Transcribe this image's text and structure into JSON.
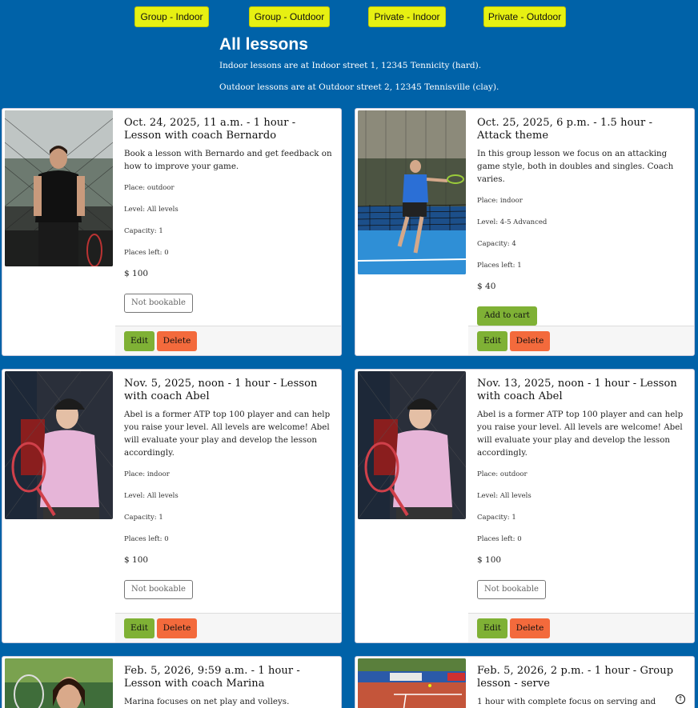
{
  "filters": [
    "Group - Indoor",
    "Group - Outdoor",
    "Private - Indoor",
    "Private - Outdoor"
  ],
  "header": {
    "title": "All lessons",
    "indoor_note": "Indoor lessons are at Indoor street 1, 12345 Tennicity (hard).",
    "outdoor_note": "Outdoor lessons are at Outdoor street 2, 12345 Tennisville (clay)."
  },
  "labels": {
    "not_bookable": "Not bookable",
    "add_to_cart": "Add to cart",
    "edit": "Edit",
    "delete": "Delete"
  },
  "lessons": [
    {
      "title": "Oct. 24, 2025, 11 a.m. - 1 hour - Lesson with coach Bernardo",
      "description": "Book a lesson with Bernardo and get feedback on how to improve your game.",
      "place": "Place: outdoor",
      "level": "Level: All levels",
      "capacity": "Capacity: 1",
      "places_left": "Places left: 0",
      "price": "$ 100"
    },
    {
      "title": "Oct. 25, 2025, 6 p.m. - 1.5 hour - Attack theme",
      "description": "In this group lesson we focus on an attacking game style, both in doubles and singles. Coach varies.",
      "place": "Place: indoor",
      "level": "Level: 4-5 Advanced",
      "capacity": "Capacity: 4",
      "places_left": "Places left: 1",
      "price": "$ 40"
    },
    {
      "title": "Nov. 5, 2025, noon - 1 hour - Lesson with coach Abel",
      "description": "Abel is a former ATP top 100 player and can help you raise your level. All levels are welcome! Abel will evaluate your play and develop the lesson accordingly.",
      "place": "Place: indoor",
      "level": "Level: All levels",
      "capacity": "Capacity: 1",
      "places_left": "Places left: 0",
      "price": "$ 100"
    },
    {
      "title": "Nov. 13, 2025, noon - 1 hour - Lesson with coach Abel",
      "description": "Abel is a former ATP top 100 player and can help you raise your level. All levels are welcome! Abel will evaluate your play and develop the lesson accordingly.",
      "place": "Place: outdoor",
      "level": "Level: All levels",
      "capacity": "Capacity: 1",
      "places_left": "Places left: 0",
      "price": "$ 100"
    },
    {
      "title": "Feb. 5, 2026, 9:59 a.m. - 1 hour - Lesson with coach Marina",
      "description": "Marina focuses on net play and volleys."
    },
    {
      "title": "Feb. 5, 2026, 2 p.m. - 1 hour - Group lesson - serve",
      "description": "1 hour with complete focus on serving and"
    }
  ]
}
